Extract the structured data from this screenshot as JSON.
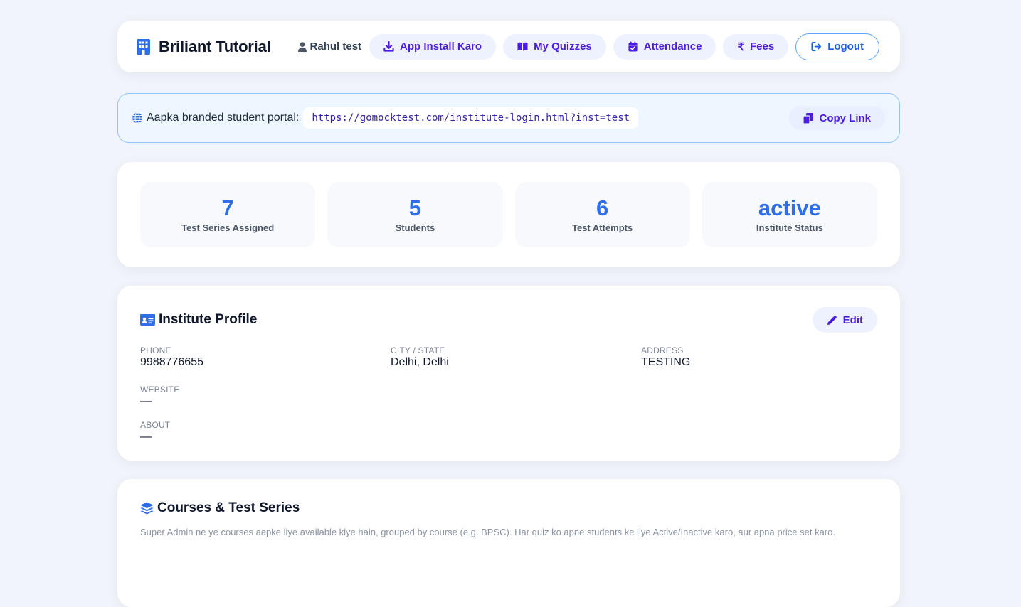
{
  "header": {
    "brand_title": "Briliant Tutorial",
    "user_name": "Rahul test",
    "nav": {
      "app_install": "App Install Karo",
      "my_quizzes": "My Quizzes",
      "attendance": "Attendance",
      "fees": "Fees",
      "logout": "Logout"
    }
  },
  "portal": {
    "label": "Aapka branded student portal:",
    "url": "https://gomocktest.com/institute-login.html?inst=test",
    "copy_label": "Copy Link"
  },
  "stats": [
    {
      "value": "7",
      "label": "Test Series Assigned"
    },
    {
      "value": "5",
      "label": "Students"
    },
    {
      "value": "6",
      "label": "Test Attempts"
    },
    {
      "value": "active",
      "label": "Institute Status"
    }
  ],
  "profile": {
    "title": "Institute Profile",
    "edit_label": "Edit",
    "fields": {
      "phone": {
        "label": "PHONE",
        "value": "9988776655"
      },
      "city": {
        "label": "CITY / STATE",
        "value": "Delhi, Delhi"
      },
      "address": {
        "label": "ADDRESS",
        "value": "TESTING"
      },
      "website": {
        "label": "WEBSITE",
        "value": "—"
      },
      "about": {
        "label": "ABOUT",
        "value": "—"
      }
    }
  },
  "courses": {
    "title": "Courses & Test Series",
    "description": "Super Admin ne ye courses aapke liye available kiye hain, grouped by course (e.g. BPSC). Har quiz ko apne students ke liye Active/Inactive karo, aur apna price set karo."
  },
  "colors": {
    "accent_blue": "#2f6ee8",
    "accent_purple": "#4c1dde",
    "page_bg": "#f1f5fb"
  },
  "icons": {
    "brand": "building-icon",
    "user": "user-icon",
    "app_install": "download-icon",
    "my_quizzes": "book-open-icon",
    "attendance": "calendar-check-icon",
    "fees": "rupee-icon",
    "logout": "sign-out-icon",
    "portal": "globe-icon",
    "copy": "copy-icon",
    "profile": "id-card-icon",
    "edit": "pencil-icon",
    "courses": "layers-icon"
  }
}
